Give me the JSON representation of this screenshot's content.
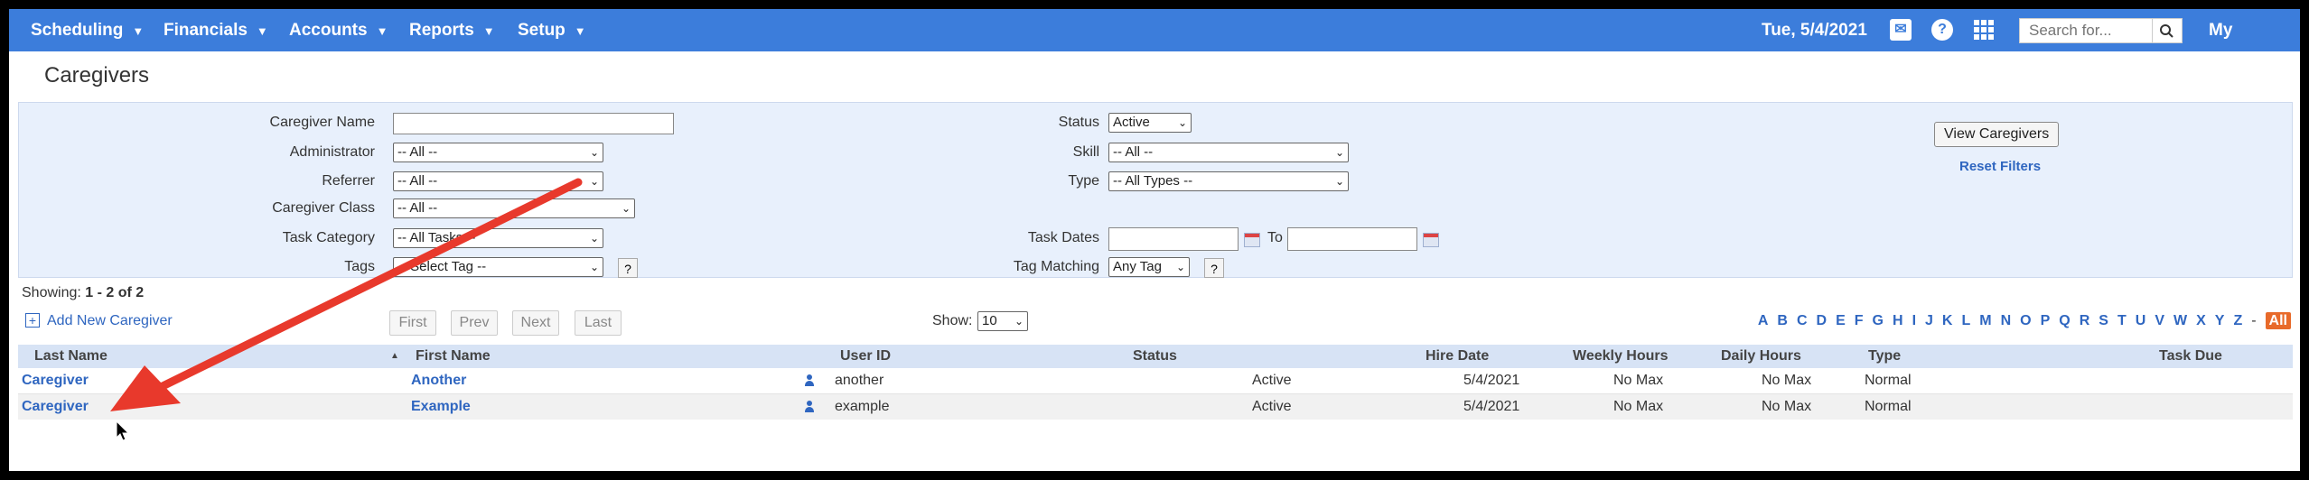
{
  "nav": {
    "items": [
      "Scheduling",
      "Financials",
      "Accounts",
      "Reports",
      "Setup"
    ],
    "date": "Tue, 5/4/2021",
    "search_placeholder": "Search for...",
    "user_menu": "My eRSP",
    "icons": [
      "mail-icon",
      "help-icon",
      "apps-grid-icon",
      "search-icon"
    ]
  },
  "page": {
    "title": "Caregivers"
  },
  "filters": {
    "caregiver_name_label": "Caregiver Name",
    "caregiver_name_value": "",
    "administrator_label": "Administrator",
    "administrator_value": "-- All --",
    "referrer_label": "Referrer",
    "referrer_value": "-- All --",
    "caregiver_class_label": "Caregiver Class",
    "caregiver_class_value": "-- All --",
    "task_category_label": "Task Category",
    "task_category_value": "-- All Tasks --",
    "tags_label": "Tags",
    "tags_value": "-- Select Tag --",
    "status_label": "Status",
    "status_value": "Active",
    "skill_label": "Skill",
    "skill_value": "-- All --",
    "type_label": "Type",
    "type_value": "-- All Types --",
    "task_dates_label": "Task Dates",
    "task_dates_to_label": "To",
    "tag_matching_label": "Tag Matching",
    "tag_matching_value": "Any Tag",
    "help_mark": "?",
    "view_button": "View Caregivers",
    "reset_link": "Reset Filters"
  },
  "listing": {
    "showing_prefix": "Showing:",
    "showing_range": "1 - 2 of 2",
    "add_new": "Add New Caregiver",
    "pager": [
      "First",
      "Prev",
      "Next",
      "Last"
    ],
    "show_label": "Show:",
    "show_value": "10",
    "alphabet": [
      "A",
      "B",
      "C",
      "D",
      "E",
      "F",
      "G",
      "H",
      "I",
      "J",
      "K",
      "L",
      "M",
      "N",
      "O",
      "P",
      "Q",
      "R",
      "S",
      "T",
      "U",
      "V",
      "W",
      "X",
      "Y",
      "Z"
    ],
    "alphabet_sep": "-",
    "alphabet_all": "All"
  },
  "table": {
    "columns": [
      "Last Name",
      "First Name",
      "User ID",
      "Status",
      "Hire Date",
      "Weekly Hours",
      "Daily Hours",
      "Type",
      "Task Due"
    ],
    "rows": [
      {
        "last": "Caregiver",
        "first": "Another",
        "user_id": "another",
        "status": "Active",
        "hire_date": "5/4/2021",
        "weekly": "No Max",
        "daily": "No Max",
        "type": "Normal",
        "task_due": ""
      },
      {
        "last": "Caregiver",
        "first": "Example",
        "user_id": "example",
        "status": "Active",
        "hire_date": "5/4/2021",
        "weekly": "No Max",
        "daily": "No Max",
        "type": "Normal",
        "task_due": ""
      }
    ]
  },
  "colors": {
    "nav_bg": "#3c7ddb",
    "filter_bg": "#e8f0fc",
    "link": "#2f66c0",
    "annotation_arrow": "#e8392c",
    "alpha_selected": "#e86a2a"
  }
}
